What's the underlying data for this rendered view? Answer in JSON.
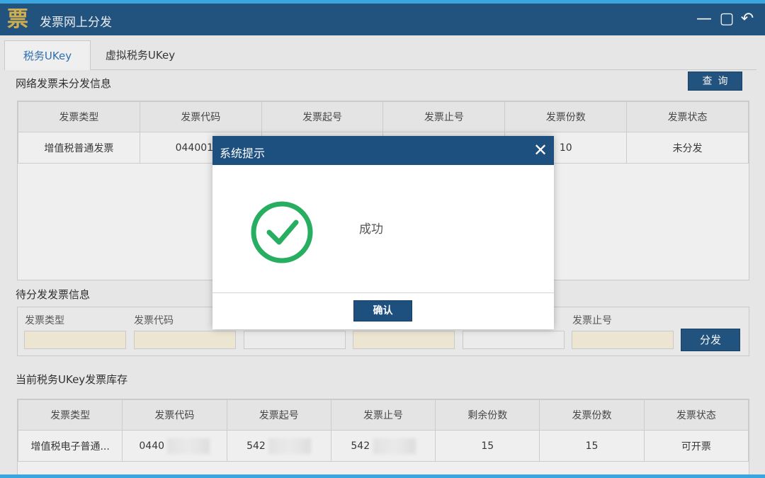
{
  "window": {
    "title": "发票网上分发",
    "logo_char": "票",
    "controls": {
      "minimize": "—",
      "maximize": "▢",
      "back": "↶"
    }
  },
  "tabs": [
    {
      "label": "税务UKey",
      "active": true
    },
    {
      "label": "虚拟税务UKey",
      "active": false
    }
  ],
  "undistributed": {
    "title": "网络发票未分发信息",
    "query_button": "查询",
    "columns": [
      "发票类型",
      "发票代码",
      "发票起号",
      "发票止号",
      "发票份数",
      "发票状态"
    ],
    "rows": [
      {
        "type": "增值税普通发票",
        "code": "04400190",
        "start": "",
        "end": "",
        "count": "10",
        "status": "未分发"
      }
    ]
  },
  "pending": {
    "title": "待分发发票信息",
    "fields": [
      {
        "label": "发票类型"
      },
      {
        "label": "发票代码"
      },
      {
        "label": ""
      },
      {
        "label": ""
      },
      {
        "label": ""
      },
      {
        "label": "发票止号"
      }
    ],
    "distribute_button": "分发"
  },
  "inventory": {
    "title": "当前税务UKey发票库存",
    "columns": [
      "发票类型",
      "发票代码",
      "发票起号",
      "发票止号",
      "剩余份数",
      "发票份数",
      "发票状态"
    ],
    "rows": [
      {
        "type": "增值税电子普通...",
        "code": "0440",
        "start": "542",
        "end": "542",
        "remaining": "15",
        "count": "15",
        "status": "可开票"
      }
    ]
  },
  "dialog": {
    "title": "系统提示",
    "close": "✕",
    "message": "成功",
    "confirm_button": "确认",
    "icon": "check-circle-icon",
    "icon_color": "#27ae60"
  },
  "colors": {
    "titlebar": "#1d507f",
    "accent_blue": "#2a6fb5",
    "input_fill": "#f4ecd7"
  }
}
